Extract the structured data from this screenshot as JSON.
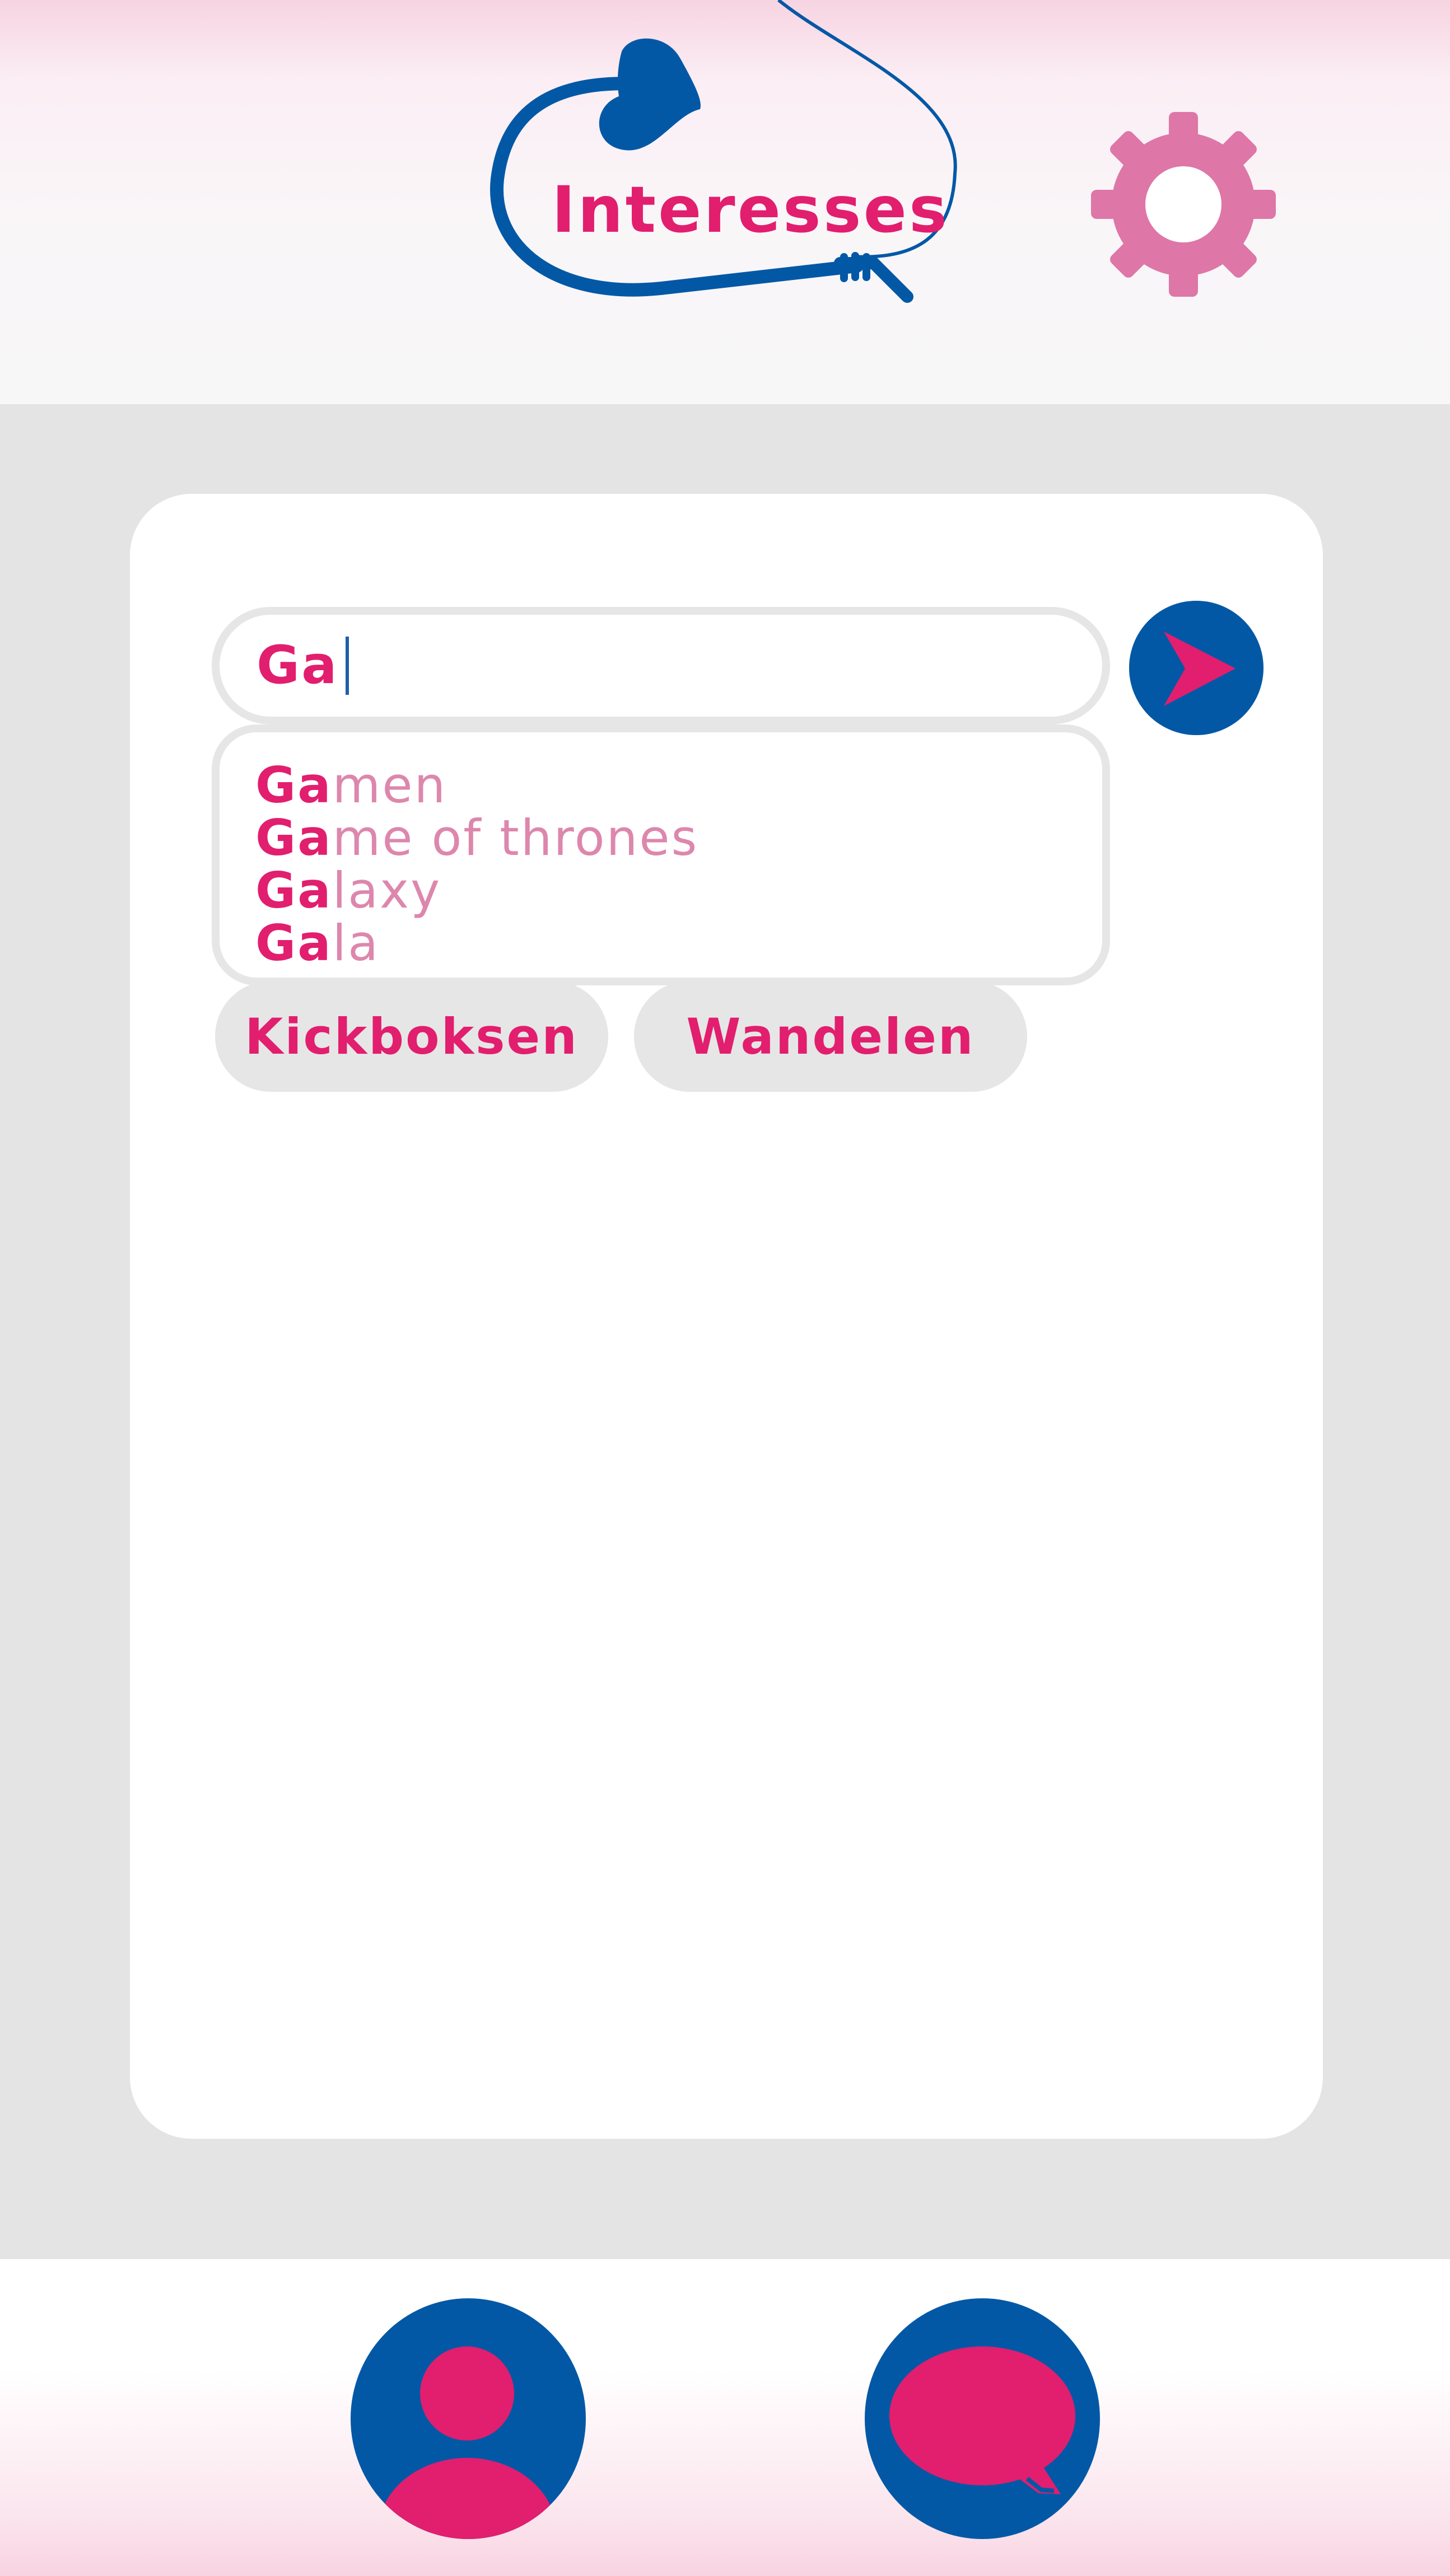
{
  "header": {
    "title": "Interesses",
    "logo_icon": "heart-arrow-rope-icon",
    "settings_icon": "gear-icon"
  },
  "search": {
    "value": "Ga",
    "send_icon": "send-arrow-icon"
  },
  "suggestions": [
    {
      "match": "Ga",
      "rest": "men"
    },
    {
      "match": "Ga",
      "rest": "me of thrones"
    },
    {
      "match": "Ga",
      "rest": "laxy"
    },
    {
      "match": "Ga",
      "rest": "la"
    }
  ],
  "interests": [
    {
      "label": "Kickboksen"
    },
    {
      "label": "Wandelen"
    }
  ],
  "nav": {
    "profile_icon": "profile-icon",
    "chat_icon": "chat-bubble-icon"
  },
  "colors": {
    "accent_pink": "#e21e6e",
    "light_pink": "#dd87ad",
    "gear_pink": "#de76a7",
    "brand_blue": "#0358a6",
    "background_gray": "#e4e4e4"
  }
}
